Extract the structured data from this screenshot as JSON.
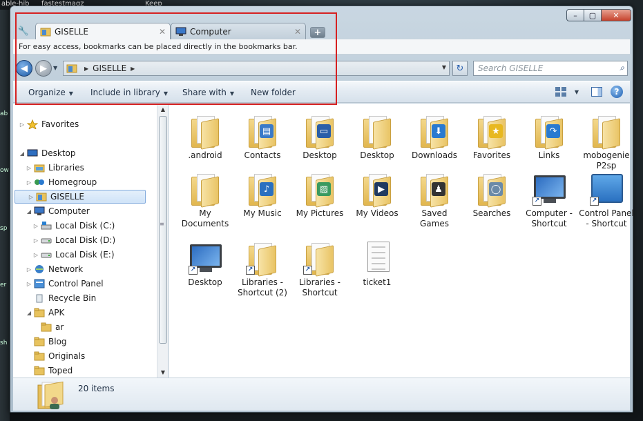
{
  "desktop": {
    "top_texts": [
      "able-hib",
      "fastestmagz",
      "Keep"
    ],
    "left_texts": [
      "ab",
      "ow",
      "sp",
      "er",
      "sh"
    ]
  },
  "window": {
    "controls": {
      "minimize": "–",
      "maximize": "▢",
      "close": "✕"
    }
  },
  "tabs": [
    {
      "label": "GISELLE",
      "icon": "giselle-folder-icon",
      "close": "✕"
    },
    {
      "label": "Computer",
      "icon": "computer-icon",
      "close": "✕"
    }
  ],
  "new_tab_label": "+",
  "bookmarks_bar": {
    "text": "For easy access, bookmarks can be placed directly in the bookmarks bar."
  },
  "address_bar": {
    "path": [
      "GISELLE"
    ],
    "search_placeholder": "Search GISELLE"
  },
  "command_bar": {
    "items": [
      "Organize",
      "Include in library",
      "Share with",
      "New folder"
    ]
  },
  "nav_pane": {
    "items": [
      {
        "label": "Favorites",
        "icon": "star-icon",
        "level": 0,
        "expander": "▷"
      },
      {
        "label": "Desktop",
        "icon": "desktop-icon",
        "level": 0,
        "expander": "◢"
      },
      {
        "label": "Libraries",
        "icon": "libraries-icon",
        "level": 1,
        "expander": "▷"
      },
      {
        "label": "Homegroup",
        "icon": "homegroup-icon",
        "level": 1,
        "expander": "▷"
      },
      {
        "label": "GISELLE",
        "icon": "user-folder-icon",
        "level": 1,
        "expander": "▷",
        "selected": true
      },
      {
        "label": "Computer",
        "icon": "computer-icon",
        "level": 1,
        "expander": "◢"
      },
      {
        "label": "Local Disk (C:)",
        "icon": "windows-drive-icon",
        "level": 2,
        "expander": "▷"
      },
      {
        "label": "Local Disk (D:)",
        "icon": "drive-icon",
        "level": 2,
        "expander": "▷"
      },
      {
        "label": "Local Disk (E:)",
        "icon": "drive-icon",
        "level": 2,
        "expander": "▷"
      },
      {
        "label": "Network",
        "icon": "network-icon",
        "level": 1,
        "expander": "▷"
      },
      {
        "label": "Control Panel",
        "icon": "control-panel-icon",
        "level": 1,
        "expander": "▷"
      },
      {
        "label": "Recycle Bin",
        "icon": "recycle-bin-icon",
        "level": 1,
        "expander": ""
      },
      {
        "label": "APK",
        "icon": "folder-icon",
        "level": 1,
        "expander": "◢"
      },
      {
        "label": "ar",
        "icon": "folder-icon",
        "level": 2,
        "expander": ""
      },
      {
        "label": "Blog",
        "icon": "folder-icon",
        "level": 1,
        "expander": ""
      },
      {
        "label": "Originals",
        "icon": "folder-icon",
        "level": 1,
        "expander": ""
      },
      {
        "label": "Toped",
        "icon": "folder-icon",
        "level": 1,
        "expander": ""
      }
    ]
  },
  "files": [
    {
      "label": ".android",
      "kind": "folder"
    },
    {
      "label": "Contacts",
      "kind": "folder",
      "badge": "▤",
      "badge_color": "#3a7ac8"
    },
    {
      "label": "Desktop",
      "kind": "folder",
      "badge": "▭",
      "badge_color": "#2a5ea8"
    },
    {
      "label": "Desktop",
      "kind": "folder"
    },
    {
      "label": "Downloads",
      "kind": "folder",
      "badge": "⬇",
      "badge_color": "#2a7ad0"
    },
    {
      "label": "Favorites",
      "kind": "folder",
      "badge": "★",
      "badge_color": "#e8b820"
    },
    {
      "label": "Links",
      "kind": "folder",
      "badge": "↷",
      "badge_color": "#2a7ad0"
    },
    {
      "label": "mobogenie P2sp",
      "kind": "folder"
    },
    {
      "label": "My Documents",
      "kind": "folder"
    },
    {
      "label": "My Music",
      "kind": "folder",
      "badge": "♪",
      "badge_color": "#2a70c0"
    },
    {
      "label": "My Pictures",
      "kind": "folder",
      "badge": "▨",
      "badge_color": "#3a9a60"
    },
    {
      "label": "My Videos",
      "kind": "folder",
      "badge": "▶",
      "badge_color": "#203a60"
    },
    {
      "label": "Saved Games",
      "kind": "folder",
      "badge": "♟",
      "badge_color": "#333333"
    },
    {
      "label": "Searches",
      "kind": "folder",
      "badge": "◯",
      "badge_color": "#6a8aa8"
    },
    {
      "label": "Computer - Shortcut",
      "kind": "monitor",
      "shortcut": true
    },
    {
      "label": "Control Panel - Shortcut",
      "kind": "cpanel",
      "shortcut": true
    },
    {
      "label": "Desktop",
      "kind": "monitor",
      "shortcut": true
    },
    {
      "label": "Libraries - Shortcut (2)",
      "kind": "folder",
      "shortcut": true
    },
    {
      "label": "Libraries - Shortcut",
      "kind": "folder",
      "shortcut": true
    },
    {
      "label": "ticket1",
      "kind": "document"
    }
  ],
  "status_bar": {
    "text": "20 items"
  },
  "colors": {
    "annotation_red": "#d62020",
    "selection": "#cfe3f8",
    "accent": "#1c5aa6"
  }
}
